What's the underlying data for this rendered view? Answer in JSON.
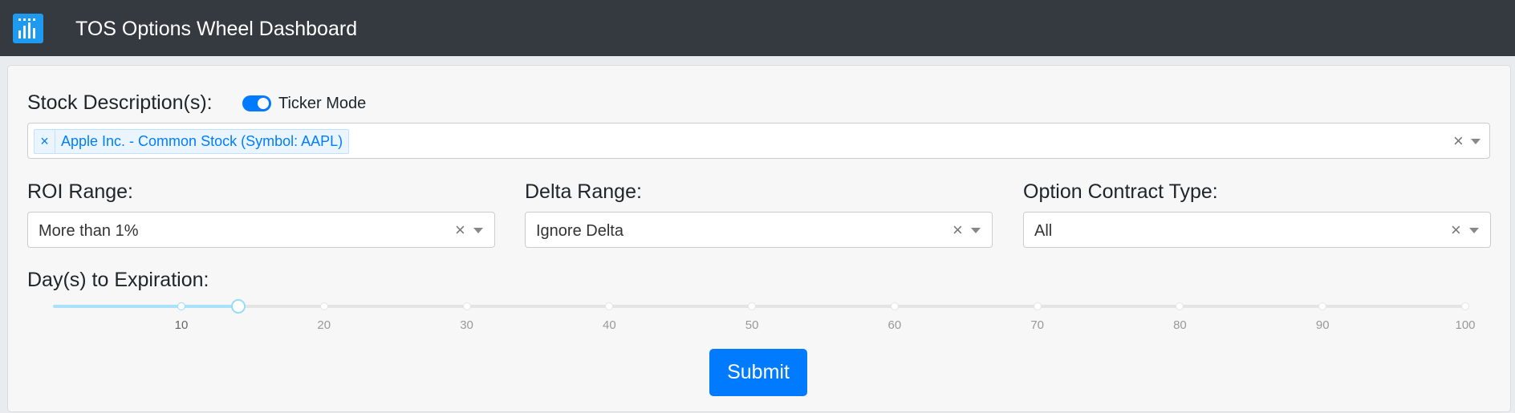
{
  "header": {
    "title": "TOS Options Wheel Dashboard",
    "logo_icon": "bar-chart-icon"
  },
  "stock": {
    "label": "Stock Description(s):",
    "toggle_label": "Ticker Mode",
    "toggle_on": true,
    "selected": [
      "Apple Inc. - Common Stock (Symbol: AAPL)"
    ],
    "chip_remove": "×",
    "clear": "×"
  },
  "roi": {
    "label": "ROI Range:",
    "value": "More than 1%",
    "clear": "×"
  },
  "delta": {
    "label": "Delta Range:",
    "value": "Ignore Delta",
    "clear": "×"
  },
  "contract": {
    "label": "Option Contract Type:",
    "value": "All",
    "clear": "×"
  },
  "expiration": {
    "label": "Day(s) to Expiration:",
    "min": 1,
    "max": 100,
    "value": 14,
    "marks": [
      "10",
      "20",
      "30",
      "40",
      "50",
      "60",
      "70",
      "80",
      "90",
      "100"
    ]
  },
  "submit_label": "Submit",
  "colors": {
    "navbar": "#343a40",
    "primary": "#007bff",
    "logo": "#1e9bf0",
    "slider_fill": "#abe2fb"
  }
}
